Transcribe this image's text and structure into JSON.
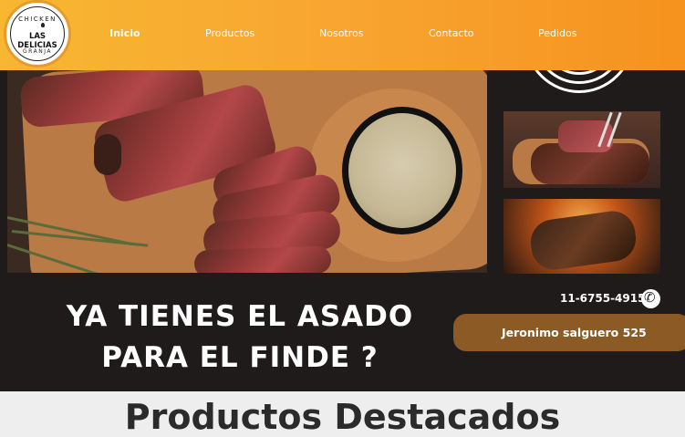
{
  "logo": {
    "top_text": "CHICKEN",
    "main_text": "LAS DELICIAS",
    "bottom_text": "GRANJA"
  },
  "nav": {
    "items": [
      {
        "label": "Inicio",
        "active": true
      },
      {
        "label": "Productos",
        "active": false
      },
      {
        "label": "Nosotros",
        "active": false
      },
      {
        "label": "Contacto",
        "active": false
      },
      {
        "label": "Pedidos",
        "active": false
      }
    ]
  },
  "hero": {
    "headline_line1": "YA TIENES EL ASADO",
    "headline_line2": "PARA EL FINDE ?",
    "phone": "11-6755-4915",
    "address": "Jeronimo salguero 525"
  },
  "products": {
    "title": "Productos Destacados"
  },
  "colors": {
    "header_start": "#f7b731",
    "header_end": "#f6921e",
    "hero_bg": "#1f1b1a",
    "address_bg": "#8c5a25"
  }
}
